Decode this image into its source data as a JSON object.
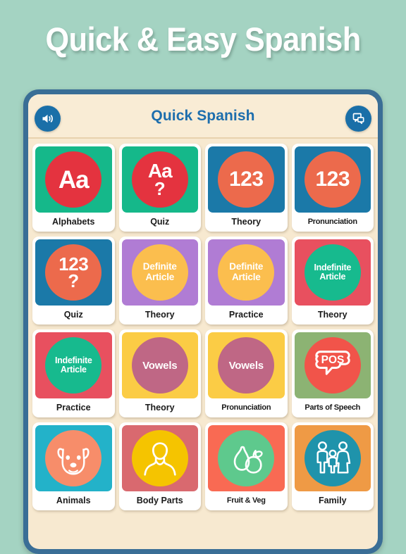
{
  "banner": {
    "title": "Quick & Easy Spanish"
  },
  "app": {
    "header": {
      "title": "Quick Spanish",
      "left_icon": "speaker-volume-icon",
      "right_icon": "chat-bubbles-icon"
    },
    "colors": {
      "page_background": "#a4d3c2",
      "device_frame": "#3a6e96",
      "screen_background": "#f7e9d0",
      "appbar_background": "#f9ecd5",
      "appbar_title": "#1d6ead",
      "icon_button": "#1a6fa8",
      "tile_card": "#ffffff",
      "tile_label": "#1a1a1a"
    },
    "tiles": [
      {
        "label": "Alphabets",
        "glyph": "Aa",
        "glyph_type": "aa",
        "tile_color": "#15b88a",
        "circle_color": "#e4333f",
        "icon": "letters-aa-icon"
      },
      {
        "label": "Quiz",
        "glyph": "Aa",
        "sub": "?",
        "glyph_type": "aa-q",
        "tile_color": "#15b88a",
        "circle_color": "#e4333f",
        "icon": "letters-aa-question-icon"
      },
      {
        "label": "Theory",
        "glyph": "123",
        "glyph_type": "num",
        "tile_color": "#1b79a8",
        "circle_color": "#ec6a4c",
        "icon": "numbers-123-icon"
      },
      {
        "label": "Pronunciation",
        "glyph": "123",
        "glyph_type": "num",
        "tile_color": "#1b79a8",
        "circle_color": "#ec6a4c",
        "icon": "numbers-123-icon"
      },
      {
        "label": "Quiz",
        "glyph": "123",
        "sub": "?",
        "glyph_type": "num-q",
        "tile_color": "#1b79a8",
        "circle_color": "#ec6a4c",
        "icon": "numbers-123-question-icon"
      },
      {
        "label": "Theory",
        "glyph": "Definite Article",
        "glyph_type": "word",
        "tile_color": "#b07cd4",
        "circle_color": "#fbbe4e",
        "icon": "definite-article-icon"
      },
      {
        "label": "Practice",
        "glyph": "Definite Article",
        "glyph_type": "word",
        "tile_color": "#b07cd4",
        "circle_color": "#fbbe4e",
        "icon": "definite-article-icon"
      },
      {
        "label": "Theory",
        "glyph": "Indefinite Article",
        "glyph_type": "word-sm",
        "tile_color": "#e8505f",
        "circle_color": "#17ba8e",
        "icon": "indefinite-article-icon"
      },
      {
        "label": "Practice",
        "glyph": "Indefinite Article",
        "glyph_type": "word-sm",
        "tile_color": "#e8505f",
        "circle_color": "#17ba8e",
        "icon": "indefinite-article-icon"
      },
      {
        "label": "Theory",
        "glyph": "Vowels",
        "glyph_type": "vowels",
        "tile_color": "#fbcc45",
        "circle_color": "#bf6785",
        "icon": "vowels-icon"
      },
      {
        "label": "Pronunciation",
        "glyph": "Vowels",
        "glyph_type": "vowels",
        "tile_color": "#fbcc45",
        "circle_color": "#bf6785",
        "icon": "vowels-icon"
      },
      {
        "label": "Parts of Speech",
        "glyph": "POS",
        "glyph_type": "pos",
        "tile_color": "#8cb373",
        "circle_color": "#f1544a",
        "icon": "speech-bubble-pos-icon"
      },
      {
        "label": "Animals",
        "glyph": "",
        "glyph_type": "dog",
        "tile_color": "#23b2c9",
        "circle_color": "#f78d6a",
        "icon": "dog-face-icon"
      },
      {
        "label": "Body Parts",
        "glyph": "",
        "glyph_type": "person",
        "tile_color": "#d9696f",
        "circle_color": "#f5c400",
        "icon": "person-bust-icon"
      },
      {
        "label": "Fruit & Veg",
        "glyph": "",
        "glyph_type": "fruit",
        "tile_color": "#f96a53",
        "circle_color": "#5ec98d",
        "icon": "fruit-pear-apple-icon"
      },
      {
        "label": "Family",
        "glyph": "",
        "glyph_type": "family",
        "tile_color": "#ef9a45",
        "circle_color": "#1f93ab",
        "icon": "family-group-icon"
      }
    ]
  }
}
